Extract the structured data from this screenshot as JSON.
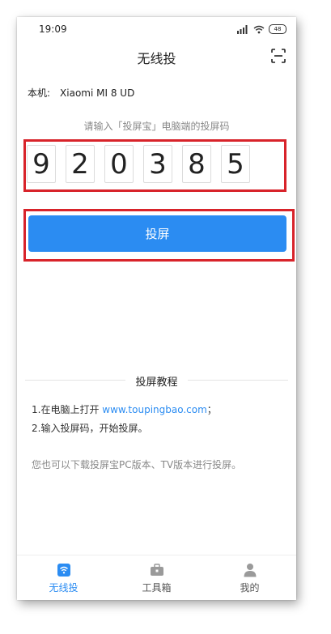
{
  "status_bar": {
    "time": "19:09",
    "battery": "48"
  },
  "header": {
    "title": "无线投"
  },
  "device": {
    "label": "本机:",
    "name": "Xiaomi MI 8 UD"
  },
  "code_prompt": "请输入「投屏宝」电脑端的投屏码",
  "code_digits": [
    "9",
    "2",
    "0",
    "3",
    "8",
    "5"
  ],
  "cast_button": {
    "label": "投屏"
  },
  "tutorial": {
    "title": "投屏教程",
    "step1_prefix": "1.在电脑上打开 ",
    "step1_link": "www.toupingbao.com",
    "step1_suffix": "；",
    "step2": "2.输入投屏码，开始投屏。",
    "note": "您也可以下载投屏宝PC版本、TV版本进行投屏。"
  },
  "tabs": [
    {
      "label": "无线投",
      "icon": "wireless-cast-icon",
      "active": true
    },
    {
      "label": "工具箱",
      "icon": "toolbox-icon",
      "active": false
    },
    {
      "label": "我的",
      "icon": "person-icon",
      "active": false
    }
  ],
  "colors": {
    "accent": "#2b8cf2",
    "highlight_frame": "#d8232a"
  }
}
